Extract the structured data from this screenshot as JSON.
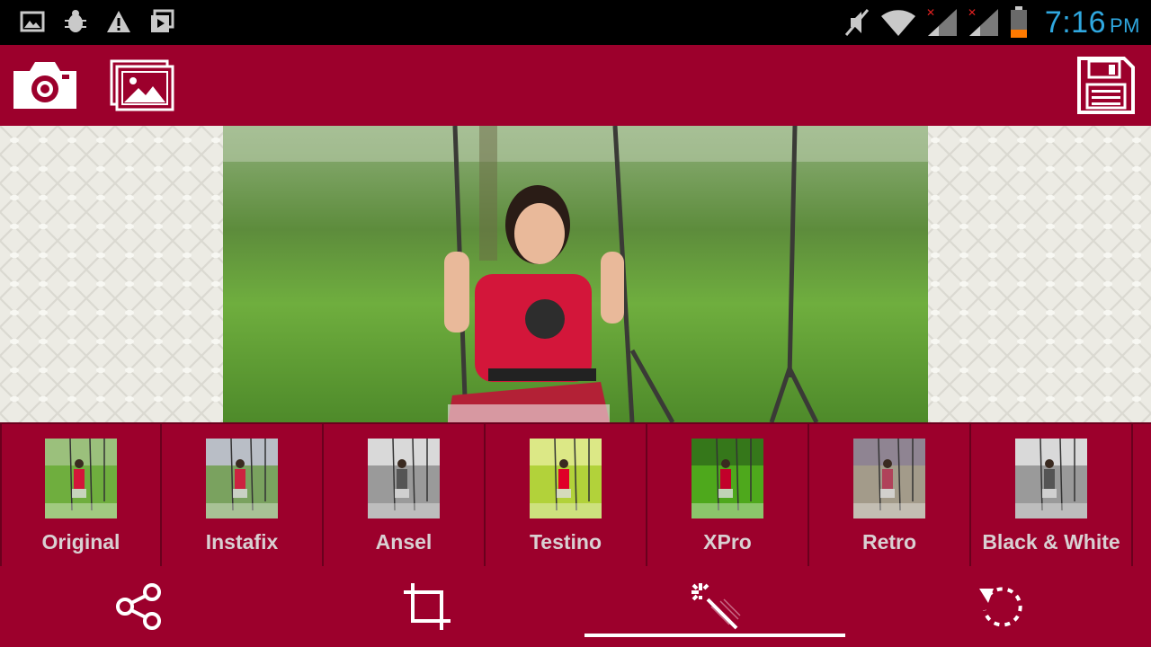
{
  "status_bar": {
    "time": "7:16",
    "ampm": "PM",
    "left_icons": [
      "image-notification-icon",
      "bug-icon",
      "warning-icon",
      "media-icon"
    ],
    "right_icons": [
      "mute-icon",
      "wifi-icon",
      "signal-1-icon",
      "signal-2-icon",
      "battery-icon"
    ],
    "clock_color": "#2fa8e0"
  },
  "toolbar": {
    "camera_icon": "camera-icon",
    "gallery_icon": "gallery-icon",
    "save_icon": "save-icon",
    "bg_color": "#9c002c"
  },
  "canvas": {
    "subject": "girl-on-swing-photo"
  },
  "filters": [
    {
      "label": "Original",
      "style": "original"
    },
    {
      "label": "Instafix",
      "style": "instafix"
    },
    {
      "label": "Ansel",
      "style": "bw"
    },
    {
      "label": "Testino",
      "style": "testino"
    },
    {
      "label": "XPro",
      "style": "xpro"
    },
    {
      "label": "Retro",
      "style": "retro"
    },
    {
      "label": "Black & White",
      "style": "bw"
    }
  ],
  "bottom_bar": {
    "buttons": [
      "share-icon",
      "crop-icon",
      "magic-wand-icon",
      "rotate-icon"
    ],
    "active_index": 2
  }
}
